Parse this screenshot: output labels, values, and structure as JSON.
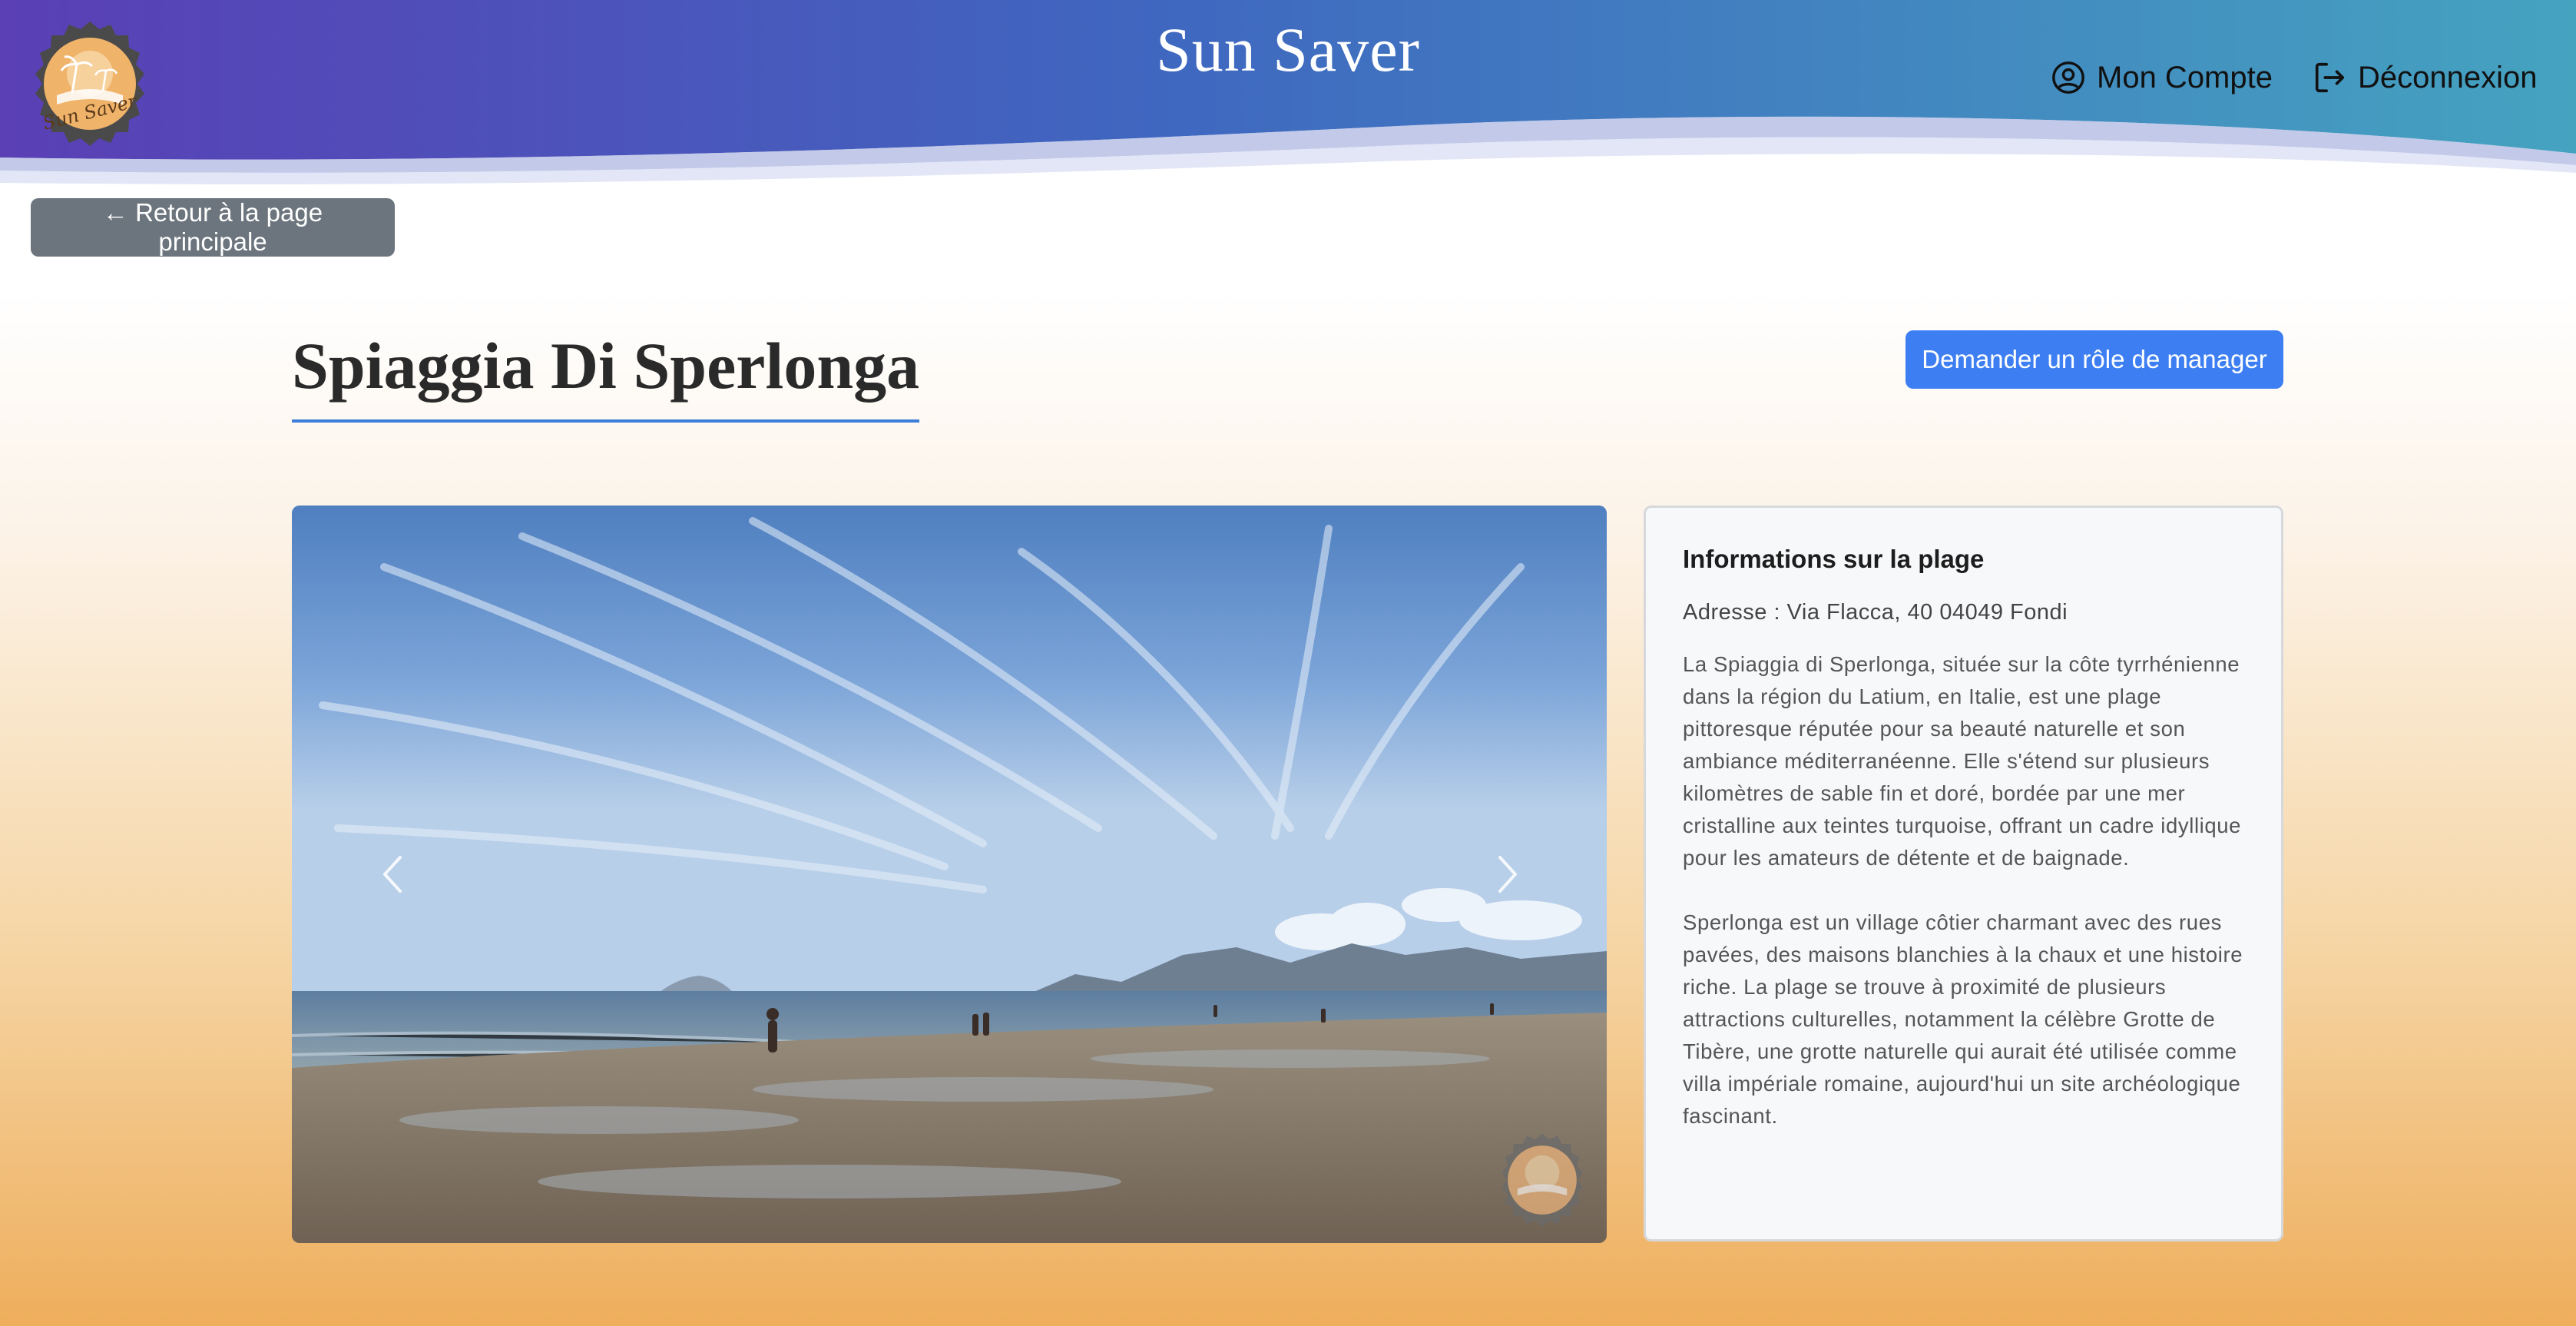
{
  "header": {
    "site_title": "Sun Saver",
    "logo_text": "Sun Saver",
    "nav": {
      "account_label": "Mon Compte",
      "logout_label": "Déconnexion"
    },
    "colors": {
      "gradient_start": "#5a3fb5",
      "gradient_mid": "#3f67c0",
      "gradient_end": "#45a3c0"
    }
  },
  "back_button": {
    "label": "← Retour à la page principale"
  },
  "beach": {
    "name": "Spiaggia Di Sperlonga",
    "manager_button_label": "Demander un rôle de manager"
  },
  "carousel": {
    "prev_icon": "chevron-left-icon",
    "next_icon": "chevron-right-icon"
  },
  "info": {
    "title": "Informations sur la plage",
    "address": "Adresse : Via Flacca, 40 04049 Fondi",
    "description_1": "La Spiaggia di Sperlonga, située sur la côte tyrrhénienne dans la région du Latium, en Italie, est une plage pittoresque réputée pour sa beauté naturelle et son ambiance méditerranéenne. Elle s'étend sur plusieurs kilomètres de sable fin et doré, bordée par une mer cristalline aux teintes turquoise, offrant un cadre idyllique pour les amateurs de détente et de baignade.",
    "description_2": "Sperlonga est un village côtier charmant avec des rues pavées, des maisons blanchies à la chaux et une histoire riche. La plage se trouve à proximité de plusieurs attractions culturelles, notamment la célèbre Grotte de Tibère, une grotte naturelle qui aurait été utilisée comme villa impériale romaine, aujourd'hui un site archéologique fascinant."
  },
  "colors": {
    "primary": "#3d7ff2",
    "secondary": "#6c757d",
    "title_underline": "#3b7dd8"
  }
}
